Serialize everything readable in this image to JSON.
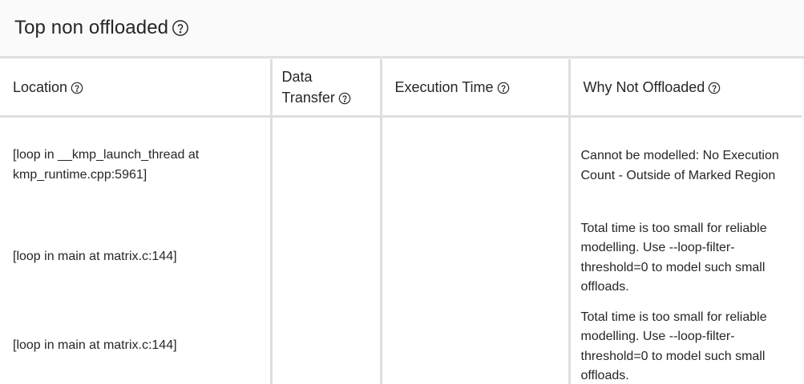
{
  "panel": {
    "title": "Top non offloaded"
  },
  "table": {
    "columns": [
      {
        "label": "Location"
      },
      {
        "label": "Data Transfer"
      },
      {
        "label": "Execution Time"
      },
      {
        "label": "Why Not Offloaded"
      }
    ],
    "rows": [
      {
        "location": "[loop in __kmp_launch_thread at kmp_runtime.cpp:5961]",
        "data_transfer": "",
        "execution_time": "",
        "why_not_offloaded": "Cannot be modelled: No Execution Count - Outside of Marked Region"
      },
      {
        "location": "[loop in main at matrix.c:144]",
        "data_transfer": "",
        "execution_time": "",
        "why_not_offloaded": "Total time is too small for reliable modelling. Use --loop-filter-threshold=0 to model such small offloads."
      },
      {
        "location": "[loop in main at matrix.c:144]",
        "data_transfer": "",
        "execution_time": "",
        "why_not_offloaded": "Total time is too small for reliable modelling. Use --loop-filter-threshold=0 to model such small offloads."
      }
    ]
  },
  "icons": {
    "help": "help-circle-icon"
  },
  "colors": {
    "background": "#fafafa",
    "table_background": "#ffffff",
    "border": "#dedede",
    "text": "#262626"
  }
}
